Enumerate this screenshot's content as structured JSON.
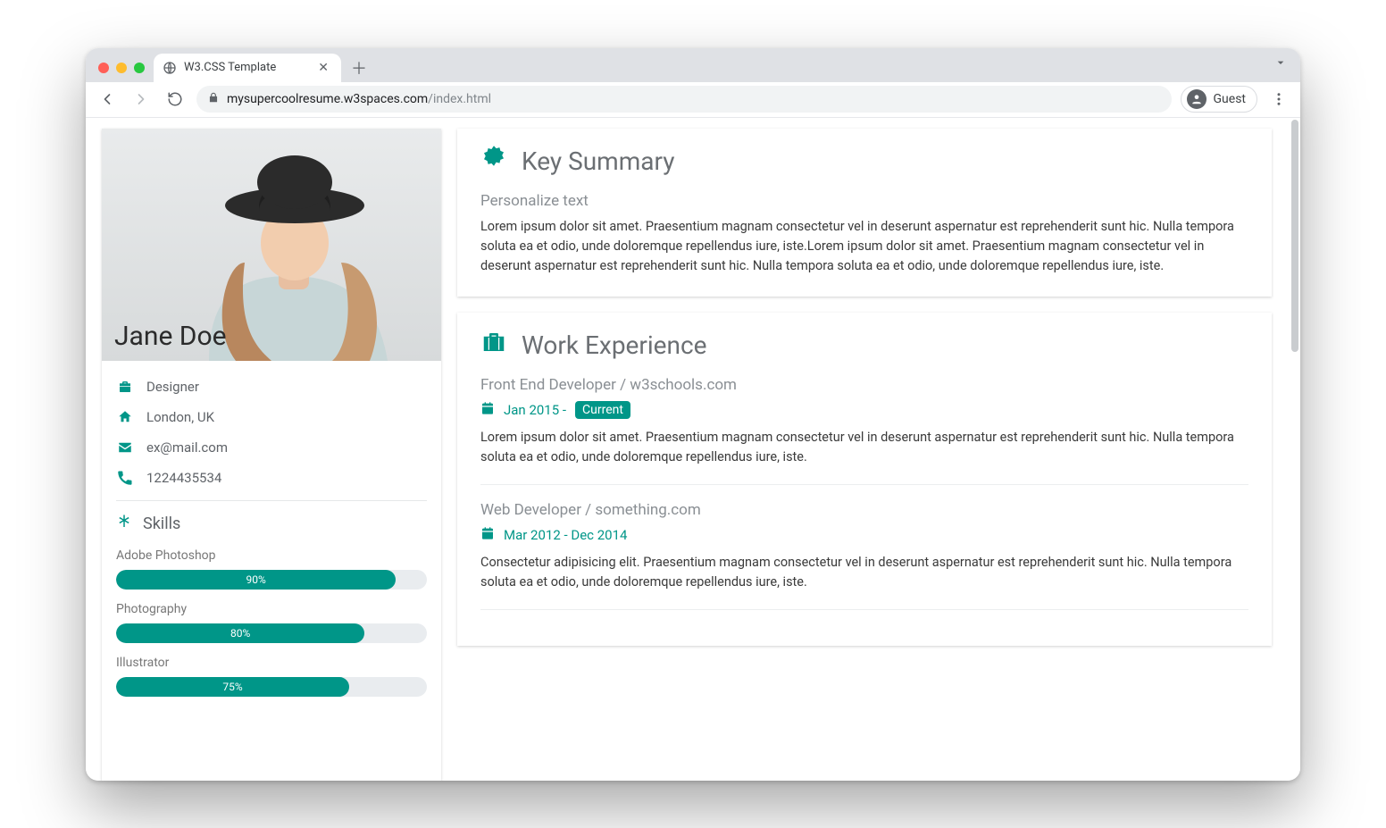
{
  "browser": {
    "tab_title": "W3.CSS Template",
    "url_host": "mysupercoolresume.w3spaces.com",
    "url_path": "/index.html",
    "guest_label": "Guest"
  },
  "colors": {
    "accent": "#009688"
  },
  "profile": {
    "name": "Jane Doe",
    "role": "Designer",
    "location": "London, UK",
    "email": "ex@mail.com",
    "phone": "1224435534"
  },
  "skills_heading": "Skills",
  "skills": [
    {
      "label": "Adobe Photoshop",
      "pct": 90,
      "pct_label": "90%"
    },
    {
      "label": "Photography",
      "pct": 80,
      "pct_label": "80%"
    },
    {
      "label": "Illustrator",
      "pct": 75,
      "pct_label": "75%"
    }
  ],
  "summary": {
    "heading": "Key Summary",
    "subheading": "Personalize text",
    "body": "Lorem ipsum dolor sit amet. Praesentium magnam consectetur vel in deserunt aspernatur est reprehenderit sunt hic. Nulla tempora soluta ea et odio, unde doloremque repellendus iure, iste.Lorem ipsum dolor sit amet. Praesentium magnam consectetur vel in deserunt aspernatur est reprehenderit sunt hic. Nulla tempora soluta ea et odio, unde doloremque repellendus iure, iste."
  },
  "work": {
    "heading": "Work Experience",
    "jobs": [
      {
        "title": "Front End Developer / w3schools.com",
        "dates_prefix": "Jan 2015 - ",
        "badge": "Current",
        "body": "Lorem ipsum dolor sit amet. Praesentium magnam consectetur vel in deserunt aspernatur est reprehenderit sunt hic. Nulla tempora soluta ea et odio, unde doloremque repellendus iure, iste."
      },
      {
        "title": "Web Developer / something.com",
        "dates": "Mar 2012 - Dec 2014",
        "body": "Consectetur adipisicing elit. Praesentium magnam consectetur vel in deserunt aspernatur est reprehenderit sunt hic. Nulla tempora soluta ea et odio, unde doloremque repellendus iure, iste."
      }
    ]
  }
}
